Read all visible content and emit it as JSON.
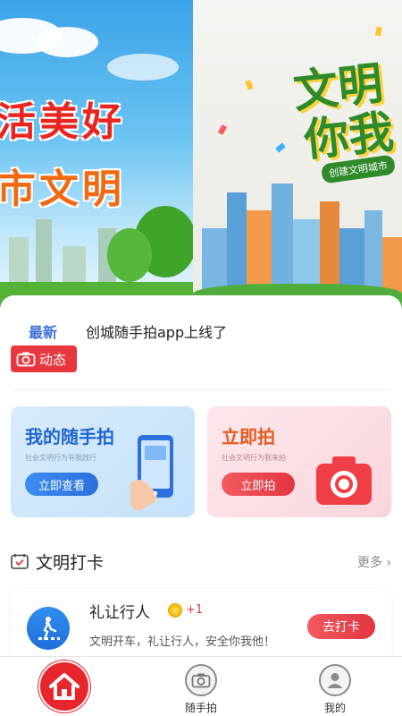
{
  "banner": {
    "left_line1": "活美好",
    "left_line2": "市文明",
    "right_big1": "文明",
    "right_big2": "你我",
    "right_ribbon": "创建文明城市"
  },
  "news": {
    "label": "最新",
    "text": "创城随手拍app上线了",
    "badge": "动态"
  },
  "cards": {
    "mine": {
      "title": "我的随手拍",
      "subtitle": "社会文明行为有我践行",
      "button": "立即查看"
    },
    "shoot": {
      "title": "立即拍",
      "subtitle": "社会文明行为我来拍",
      "button": "立即拍"
    }
  },
  "section": {
    "title": "文明打卡",
    "more": "更多"
  },
  "checkin": {
    "title": "礼让行人",
    "points": "+1",
    "desc": "文明开车，礼让行人，安全你我他！",
    "button": "去打卡"
  },
  "tabbar": {
    "photo": "随手拍",
    "mine": "我的"
  },
  "colors": {
    "accent_red": "#e8373f",
    "accent_blue": "#2c6fde",
    "green": "#2f8b2a"
  }
}
